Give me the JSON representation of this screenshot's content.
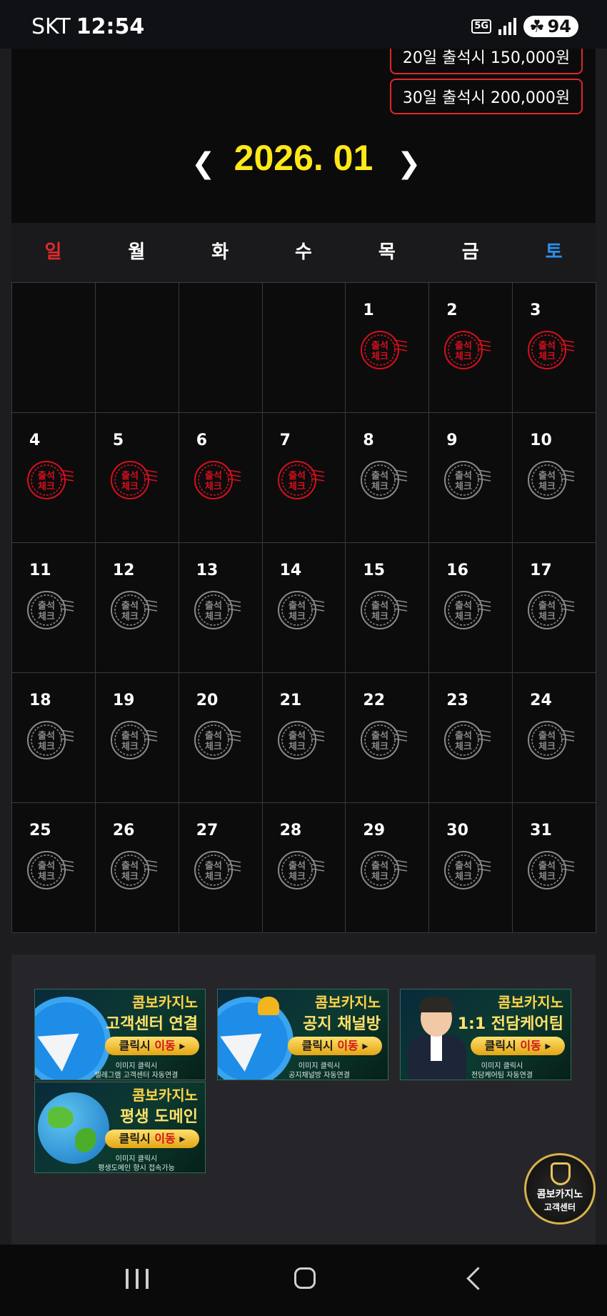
{
  "status_bar": {
    "carrier": "SKT",
    "time": "12:54",
    "network": "5G",
    "battery": "94"
  },
  "rewards": [
    {
      "label": "20일 출석시 150,000원"
    },
    {
      "label": "30일 출석시 200,000원"
    }
  ],
  "calendar": {
    "title": "2026. 01",
    "prev_icon": "chevron-left-icon",
    "next_icon": "chevron-right-icon",
    "weekdays": [
      "일",
      "월",
      "화",
      "수",
      "목",
      "금",
      "토"
    ],
    "weekday_colors": {
      "sunday": "#e02a2a",
      "saturday": "#2e8fe8",
      "other": "#ffffff"
    },
    "leading_empty_cells": 4,
    "stamp_text": [
      "출석",
      "체크"
    ],
    "checked_color": "#d6101c",
    "unchecked_color": "#8a8a8a",
    "days": [
      {
        "day": "1",
        "checked": true
      },
      {
        "day": "2",
        "checked": true
      },
      {
        "day": "3",
        "checked": true
      },
      {
        "day": "4",
        "checked": true
      },
      {
        "day": "5",
        "checked": true
      },
      {
        "day": "6",
        "checked": true
      },
      {
        "day": "7",
        "checked": true
      },
      {
        "day": "8",
        "checked": false
      },
      {
        "day": "9",
        "checked": false
      },
      {
        "day": "10",
        "checked": false
      },
      {
        "day": "11",
        "checked": false
      },
      {
        "day": "12",
        "checked": false
      },
      {
        "day": "13",
        "checked": false
      },
      {
        "day": "14",
        "checked": false
      },
      {
        "day": "15",
        "checked": false
      },
      {
        "day": "16",
        "checked": false
      },
      {
        "day": "17",
        "checked": false
      },
      {
        "day": "18",
        "checked": false
      },
      {
        "day": "19",
        "checked": false
      },
      {
        "day": "20",
        "checked": false
      },
      {
        "day": "21",
        "checked": false
      },
      {
        "day": "22",
        "checked": false
      },
      {
        "day": "23",
        "checked": false
      },
      {
        "day": "24",
        "checked": false
      },
      {
        "day": "25",
        "checked": false
      },
      {
        "day": "26",
        "checked": false
      },
      {
        "day": "27",
        "checked": false
      },
      {
        "day": "28",
        "checked": false
      },
      {
        "day": "29",
        "checked": false
      },
      {
        "day": "30",
        "checked": false
      },
      {
        "day": "31",
        "checked": false
      }
    ]
  },
  "banners": [
    {
      "line1": "콤보카지노",
      "line2": "고객센터 연결",
      "button_a": "클릭시 ",
      "button_b": "이동",
      "caption1": "이미지 클릭시",
      "caption2": "텔레그램 고객센터 자동연결"
    },
    {
      "line1": "콤보카지노",
      "line2": "공지 채널방",
      "button_a": "클릭시 ",
      "button_b": "이동",
      "caption1": "이미지 클릭시",
      "caption2": "공지채널방 자동연결"
    },
    {
      "line1": "콤보카지노",
      "line2": "1:1 전담케어팀",
      "button_a": "클릭시 ",
      "button_b": "이동",
      "caption1": "이미지 클릭시",
      "caption2": "전담케어팀 자동연결"
    },
    {
      "line1": "콤보카지노",
      "line2": "평생 도메인",
      "button_a": "클릭시 ",
      "button_b": "이동",
      "caption1": "이미지 클릭시",
      "caption2": "평생도메인 항시 접속가능"
    }
  ],
  "cs_button": {
    "line1": "콤보카지노",
    "line2": "고객센터"
  },
  "accent_colors": {
    "title_yellow": "#ffe818",
    "reward_border": "#e02727"
  }
}
